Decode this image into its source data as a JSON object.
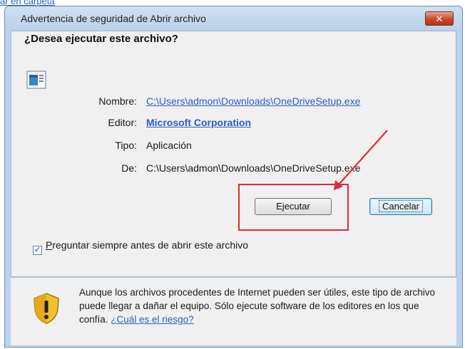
{
  "top_link": "ar en carpeta",
  "dialog": {
    "title": "Advertencia de seguridad de Abrir archivo",
    "close_label": "✕",
    "question": "¿Desea ejecutar este archivo?",
    "fields": {
      "name_label": "Nombre:",
      "name_value": "C:\\Users\\admon\\Downloads\\OneDriveSetup.exe",
      "publisher_label": "Editor:",
      "publisher_value": "Microsoft Corporation",
      "type_label": "Tipo:",
      "type_value": "Aplicación",
      "from_label": "De:",
      "from_value": "C:\\Users\\admon\\Downloads\\OneDriveSetup.exe"
    },
    "buttons": {
      "run": "Ejecutar",
      "cancel": "Cancelar"
    },
    "checkbox": {
      "checked": true,
      "label_first": "P",
      "label_rest": "reguntar siempre antes de abrir este archivo"
    },
    "warning": {
      "text": "Aunque los archivos procedentes de Internet pueden ser útiles, este tipo de archivo puede llegar a dañar el equipo. Sólo ejecute software de los editores en los que confía. ",
      "link": "¿Cuál es el riesgo?"
    }
  },
  "colors": {
    "highlight": "#e2283a",
    "link": "#2b5fc4"
  },
  "icons": [
    "file-icon",
    "shield-warning-icon",
    "close-icon",
    "red-arrow-annotation"
  ]
}
